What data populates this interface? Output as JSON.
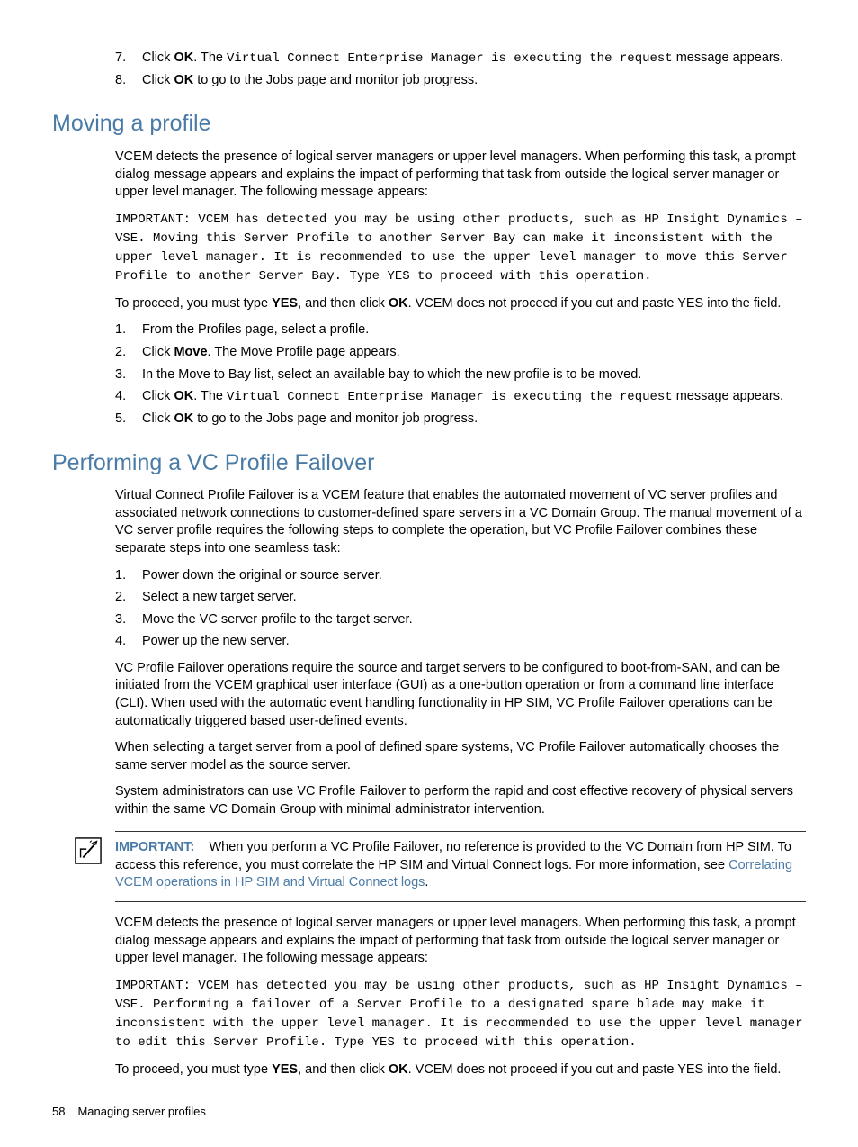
{
  "topList": {
    "items": [
      {
        "num": "7.",
        "pre": "Click ",
        "bold1": "OK",
        "mid1": ". The ",
        "mono": "Virtual Connect Enterprise Manager is executing the request",
        "mid2": " message appears."
      },
      {
        "num": "8.",
        "pre": "Click ",
        "bold1": "OK",
        "mid1": " to go to the Jobs page and monitor job progress."
      }
    ]
  },
  "section1": {
    "heading": "Moving a profile",
    "p1": "VCEM detects the presence of logical server managers or upper level managers. When performing this task, a prompt dialog message appears and explains the impact of performing that task from outside the logical server manager or upper level manager. The following message appears:",
    "code1": "IMPORTANT: VCEM has detected you may be using other products, such as HP Insight Dynamics – VSE. Moving this Server Profile to another Server Bay can make it inconsistent with the upper level manager. It is recommended to use the upper level manager to move this Server Profile to another Server Bay. Type YES to proceed with this operation.",
    "p2_pre": "To proceed, you must type ",
    "p2_b1": "YES",
    "p2_mid": ", and then click ",
    "p2_b2": "OK",
    "p2_post": ". VCEM does not proceed if you cut and paste YES into the field.",
    "steps": [
      {
        "num": "1.",
        "text": "From the Profiles page, select a profile."
      },
      {
        "num": "2.",
        "pre": "Click ",
        "bold1": "Move",
        "post": ". The Move Profile page appears."
      },
      {
        "num": "3.",
        "text": "In the Move to Bay list, select an available bay to which the new profile is to be moved."
      },
      {
        "num": "4.",
        "pre": "Click ",
        "bold1": "OK",
        "mid1": ". The ",
        "mono": "Virtual Connect Enterprise Manager is executing the request",
        "mid2": " message appears."
      },
      {
        "num": "5.",
        "pre": "Click ",
        "bold1": "OK",
        "mid1": " to go to the Jobs page and monitor job progress."
      }
    ]
  },
  "section2": {
    "heading": "Performing a VC Profile Failover",
    "p1": "Virtual Connect Profile Failover is a VCEM feature that enables the automated movement of VC server profiles and associated network connections to customer-defined spare servers in a VC Domain Group. The manual movement of a VC server profile requires the following steps to complete the operation, but VC Profile Failover combines these separate steps into one seamless task:",
    "steps": [
      {
        "num": "1.",
        "text": "Power down the original or source server."
      },
      {
        "num": "2.",
        "text": "Select a new target server."
      },
      {
        "num": "3.",
        "text": "Move the VC server profile to the target server."
      },
      {
        "num": "4.",
        "text": "Power up the new server."
      }
    ],
    "p2": "VC Profile Failover operations require the source and target servers to be configured to boot-from-SAN, and can be initiated from the VCEM graphical user interface (GUI) as a one-button operation or from a command line interface (CLI). When used with the automatic event handling functionality in HP SIM, VC Profile Failover operations can be automatically triggered based user-defined events.",
    "p3": "When selecting a target server from a pool of defined spare systems, VC Profile Failover automatically chooses the same server model as the source server.",
    "p4": "System administrators can use VC Profile Failover to perform the rapid and cost effective recovery of physical servers within the same VC Domain Group with minimal administrator intervention.",
    "important": {
      "label": "IMPORTANT:",
      "text_pre": "When you perform a VC Profile Failover, no reference is provided to the VC Domain from HP SIM. To access this reference, you must correlate the HP SIM and Virtual Connect logs. For more information, see ",
      "link": "Correlating VCEM operations in HP SIM and Virtual Connect logs",
      "text_post": "."
    },
    "p5": "VCEM detects the presence of logical server managers or upper level managers. When performing this task, a prompt dialog message appears and explains the impact of performing that task from outside the logical server manager or upper level manager. The following message appears:",
    "code2": "IMPORTANT: VCEM has detected you may be using other products, such as HP Insight Dynamics – VSE. Performing a failover of a Server Profile to a designated spare blade may make it inconsistent with the upper level manager. It is recommended to use the upper level manager to edit this Server Profile. Type YES to proceed with this operation.",
    "p6_pre": "To proceed, you must type ",
    "p6_b1": "YES",
    "p6_mid": ", and then click ",
    "p6_b2": "OK",
    "p6_post": ". VCEM does not proceed if you cut and paste YES into the field."
  },
  "footer": {
    "page": "58",
    "title": "Managing server profiles"
  }
}
